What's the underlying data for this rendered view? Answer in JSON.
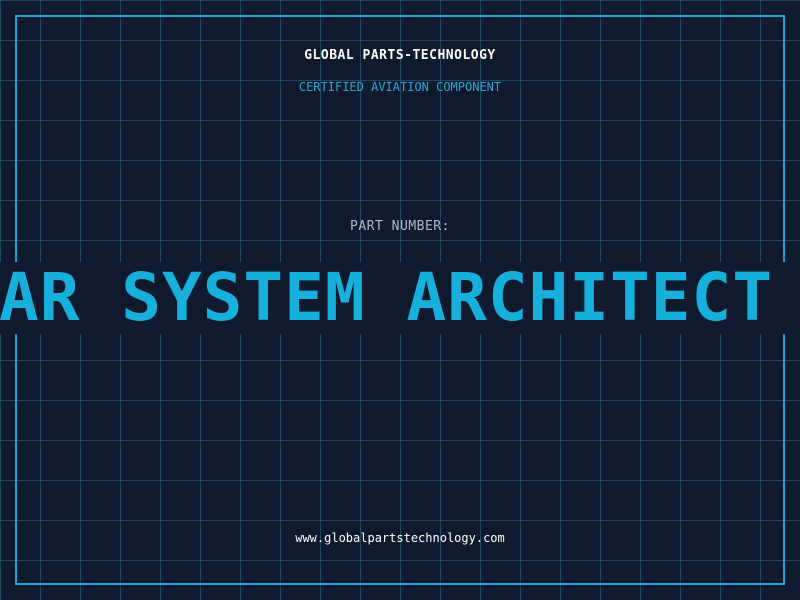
{
  "header": {
    "brand": "GLOBAL PARTS-TECHNOLOGY",
    "subtitle": "CERTIFIED AVIATION COMPONENT"
  },
  "part": {
    "label": "PART NUMBER:",
    "value": "AR SYSTEM ARCHITECT"
  },
  "footer": {
    "url": "www.globalpartstechnology.com"
  },
  "colors": {
    "background": "#0f1a2e",
    "accent": "#17b0dc",
    "frame": "#1fa3d0",
    "grid": "#286e8c"
  }
}
